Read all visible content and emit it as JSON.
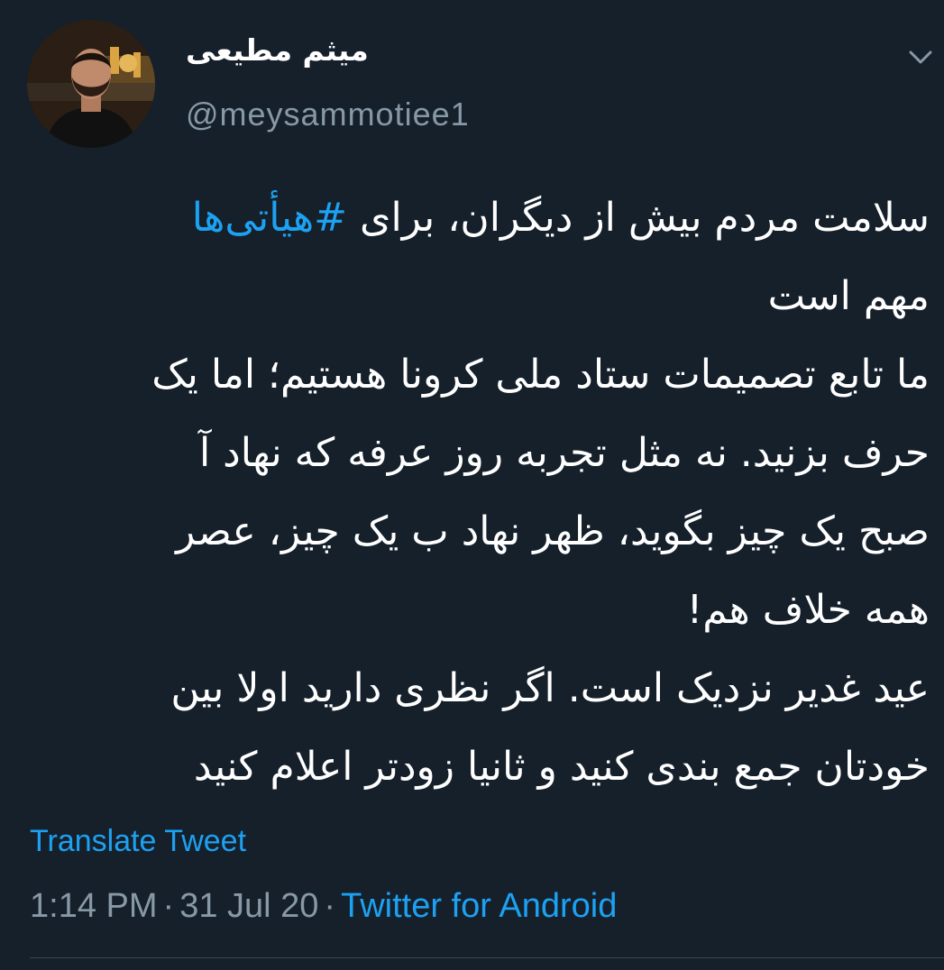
{
  "author": {
    "display_name": "میثم مطیعی",
    "handle": "@meysammotiee1"
  },
  "tweet": {
    "line1_prefix": "سلامت مردم بیش از دیگران، برای ",
    "hashtag": "#هیأتی‌ها",
    "line2": "مهم است",
    "line3": "ما تابع تصمیمات ستاد ملی کرونا هستیم؛ اما یک",
    "line4": "حرف بزنید. نه مثل تجربه روز عرفه که نهاد آ",
    "line5": "صبح یک چیز بگوید، ظهر نهاد ب یک چیز، عصر",
    "line6": "همه خلاف هم!",
    "line7": "عید غدیر نزدیک است. اگر نظری دارید اولا بین",
    "line8": "خودتان جمع بندی کنید و ثانیا زودتر اعلام کنید"
  },
  "translate_label": "Translate Tweet",
  "meta": {
    "time": "1:14 PM",
    "separator": "·",
    "date": "31 Jul 20",
    "source": "Twitter for Android"
  },
  "icons": {
    "chevron": "chevron-down-icon",
    "avatar": "profile-avatar"
  },
  "colors": {
    "background": "#15202b",
    "text": "#ffffff",
    "secondary": "#8899a6",
    "accent": "#1da1f2"
  }
}
